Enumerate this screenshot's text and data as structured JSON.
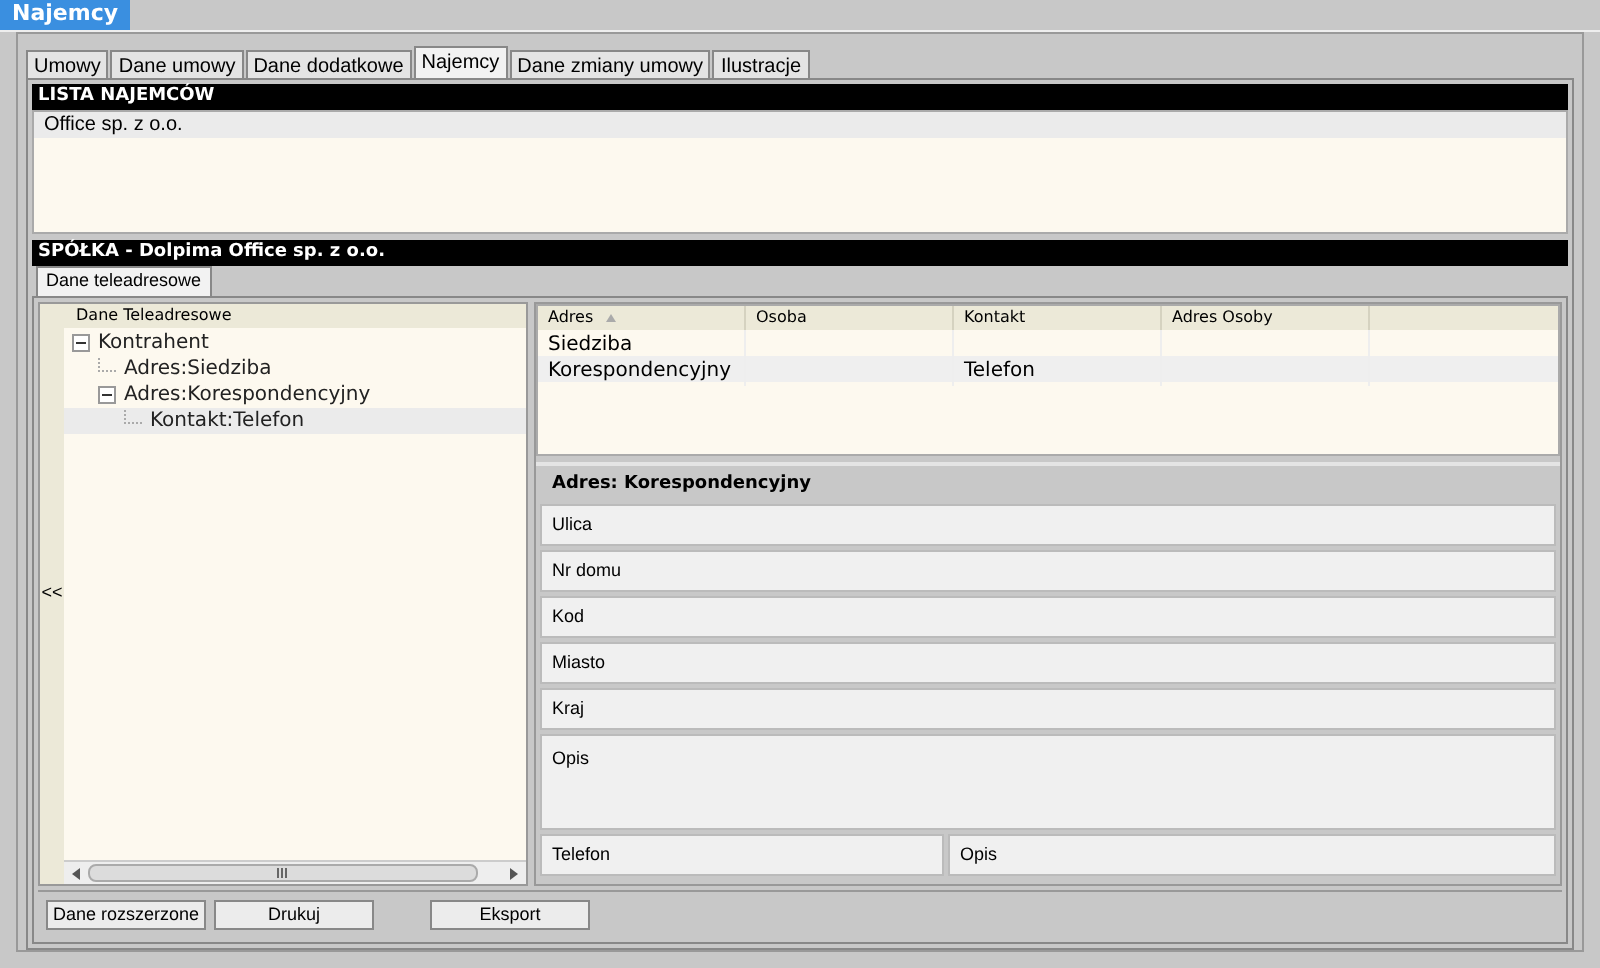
{
  "window": {
    "title": "Najemcy"
  },
  "tabs": [
    {
      "label": "Umowy",
      "selected": false
    },
    {
      "label": "Dane umowy",
      "selected": false
    },
    {
      "label": "Dane dodatkowe",
      "selected": false
    },
    {
      "label": "Najemcy",
      "selected": true
    },
    {
      "label": "Dane zmiany umowy",
      "selected": false
    },
    {
      "label": "Ilustracje",
      "selected": false
    }
  ],
  "tenants": {
    "title": "LISTA NAJEMCÓW",
    "items": [
      {
        "label": "Office sp. z o.o.",
        "selected": true
      }
    ]
  },
  "company": {
    "title": "SPÓŁKA - Dolpima Office sp. z o.o.",
    "tabs": [
      {
        "label": "Dane teleadresowe",
        "selected": true
      }
    ]
  },
  "collapse_button": "<<",
  "tree": {
    "header": "Dane Teleadresowe",
    "items": [
      {
        "label": "Kontrahent",
        "expanded": true,
        "selected": false,
        "children": [
          {
            "label": "Adres:Siedziba",
            "selected": false
          },
          {
            "label": "Adres:Korespondencyjny",
            "expanded": true,
            "selected": false,
            "children": [
              {
                "label": "Kontakt:Telefon",
                "selected": true
              }
            ]
          }
        ]
      }
    ]
  },
  "table": {
    "columns": [
      {
        "label": "Adres",
        "sorted": true
      },
      {
        "label": "Osoba",
        "sorted": false
      },
      {
        "label": "Kontakt",
        "sorted": false
      },
      {
        "label": "Adres Osoby",
        "sorted": false
      }
    ],
    "rows": [
      {
        "cells": [
          "Siedziba",
          "",
          "",
          ""
        ],
        "selected": false
      },
      {
        "cells": [
          "Korespondencyjny",
          "",
          "Telefon",
          ""
        ],
        "selected": true
      }
    ]
  },
  "address": {
    "title": "Adres: Korespondencyjny",
    "fields": [
      {
        "label": "Ulica",
        "kind": "line"
      },
      {
        "label": "Nr domu",
        "kind": "line"
      },
      {
        "label": "Kod",
        "kind": "line"
      },
      {
        "label": "Miasto",
        "kind": "line"
      },
      {
        "label": "Kraj",
        "kind": "line"
      },
      {
        "label": "Opis",
        "kind": "area"
      }
    ],
    "contact_fields": [
      "Telefon",
      "Opis"
    ]
  },
  "buttons": [
    "Dane rozszerzone",
    "Drukuj",
    "Eksport"
  ]
}
